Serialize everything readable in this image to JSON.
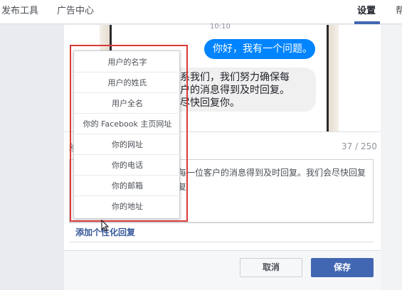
{
  "topbar": {
    "tabs": [
      {
        "label": "发布工具"
      },
      {
        "label": "广告中心"
      },
      {
        "label": "设置"
      },
      {
        "label": "帮"
      }
    ]
  },
  "preview": {
    "time": "10:10",
    "outgoing_message": "你好，我有一个问题。",
    "incoming_lines": [
      "系我们，我们努力确保每",
      "户的消息得到及时回复。",
      "尽快回复你。"
    ]
  },
  "editor": {
    "label_fragment": "移",
    "counter": "37 / 250",
    "text_lines": [
      "每一位客户的消息得到及时回复。我们会尽快回复",
      "复"
    ],
    "add_personal_label": "添加个性化回复"
  },
  "dropdown": {
    "items": [
      {
        "label": "用户的名字"
      },
      {
        "label": "用户的姓氏"
      },
      {
        "label": "用户全名"
      },
      {
        "label": "你的 Facebook 主页网址"
      },
      {
        "label": "你的网址"
      },
      {
        "label": "你的电话"
      },
      {
        "label": "你的邮箱"
      },
      {
        "label": "你的地址"
      }
    ]
  },
  "footer": {
    "cancel_label": "取消",
    "save_label": "保存"
  },
  "colors": {
    "accent": "#4267b2",
    "messenger_blue": "#0084ff",
    "highlight_red": "#d93a3a"
  }
}
